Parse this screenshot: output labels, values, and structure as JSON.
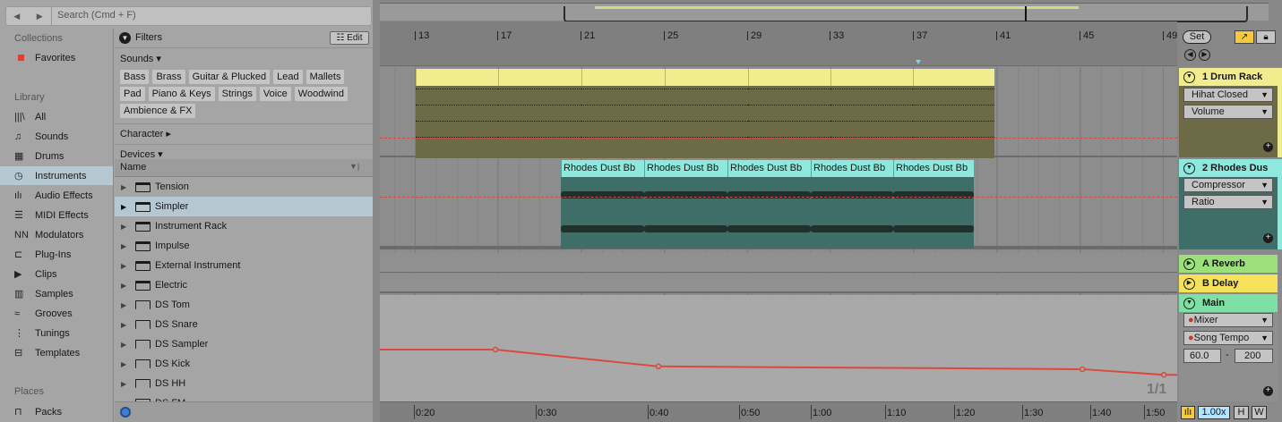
{
  "browser": {
    "search_placeholder": "Search (Cmd + F)",
    "nav_back": "◀",
    "nav_fwd": "▶",
    "collections_heading": "Collections",
    "favorites": "Favorites",
    "library_heading": "Library",
    "library_items": [
      {
        "label": "All",
        "icon": "|||\\"
      },
      {
        "label": "Sounds",
        "icon": "♫"
      },
      {
        "label": "Drums",
        "icon": "▦"
      },
      {
        "label": "Instruments",
        "icon": "◷"
      },
      {
        "label": "Audio Effects",
        "icon": "ılı"
      },
      {
        "label": "MIDI Effects",
        "icon": "☰"
      },
      {
        "label": "Modulators",
        "icon": "NN"
      },
      {
        "label": "Plug-Ins",
        "icon": "⊏"
      },
      {
        "label": "Clips",
        "icon": "▶"
      },
      {
        "label": "Samples",
        "icon": "▥"
      },
      {
        "label": "Grooves",
        "icon": "≈"
      },
      {
        "label": "Tunings",
        "icon": "⋮"
      },
      {
        "label": "Templates",
        "icon": "⊟"
      }
    ],
    "selected_library_item": "Instruments",
    "places_heading": "Places",
    "packs": "Packs",
    "filters_label": "Filters",
    "edit_label": "Edit",
    "sounds_label": "Sounds ▾",
    "sound_tags": [
      "Bass",
      "Brass",
      "Guitar & Plucked",
      "Lead",
      "Mallets",
      "Pad",
      "Piano & Keys",
      "Strings",
      "Voice",
      "Woodwind",
      "Ambience & FX"
    ],
    "character_label": "Character ▸",
    "devices_label": "Devices ▾",
    "name_header": "Name",
    "items": [
      "Tension",
      "Simpler",
      "Instrument Rack",
      "Impulse",
      "External Instrument",
      "Electric",
      "DS Tom",
      "DS Snare",
      "DS Sampler",
      "DS Kick",
      "DS HH",
      "DS FM"
    ],
    "selected_item": "Simpler"
  },
  "ruler": {
    "bars": [
      "13",
      "17",
      "21",
      "25",
      "29",
      "33",
      "37",
      "41",
      "45",
      "49"
    ]
  },
  "clips": {
    "track2_clip_name": "Rhodes Dust Bb"
  },
  "mixer": {
    "set_label": "Set",
    "track1": {
      "name": "1 Drum Rack",
      "device": "Hihat Closed",
      "param": "Volume",
      "color": "#f1ec8d"
    },
    "track2": {
      "name": "2 Rhodes Dus",
      "device": "Compressor",
      "param": "Ratio",
      "color": "#8ee8de"
    },
    "return_a": {
      "name": "A Reverb",
      "color": "#9be07a"
    },
    "return_b": {
      "name": "B Delay",
      "color": "#f6e15a"
    },
    "main": {
      "name": "Main",
      "device": "Mixer",
      "param": "Song Tempo",
      "min": "60.0",
      "max": "200",
      "dash": "-",
      "color": "#7fe0a6"
    }
  },
  "timeline": {
    "times": [
      "0:20",
      "0:30",
      "0:40",
      "0:50",
      "1:00",
      "1:10",
      "1:20",
      "1:30",
      "1:40",
      "1:50"
    ],
    "page_indicator": "1/1"
  },
  "status": {
    "zoom": "1.00x",
    "h": "H",
    "w": "W"
  },
  "automation": {
    "param": "Song Tempo",
    "points": [
      {
        "time": "0:30",
        "bpm": 129
      },
      {
        "time": "0:50",
        "bpm": 105
      },
      {
        "time": "1:42",
        "bpm": 101
      },
      {
        "time": "1:52",
        "bpm": 93
      }
    ]
  }
}
